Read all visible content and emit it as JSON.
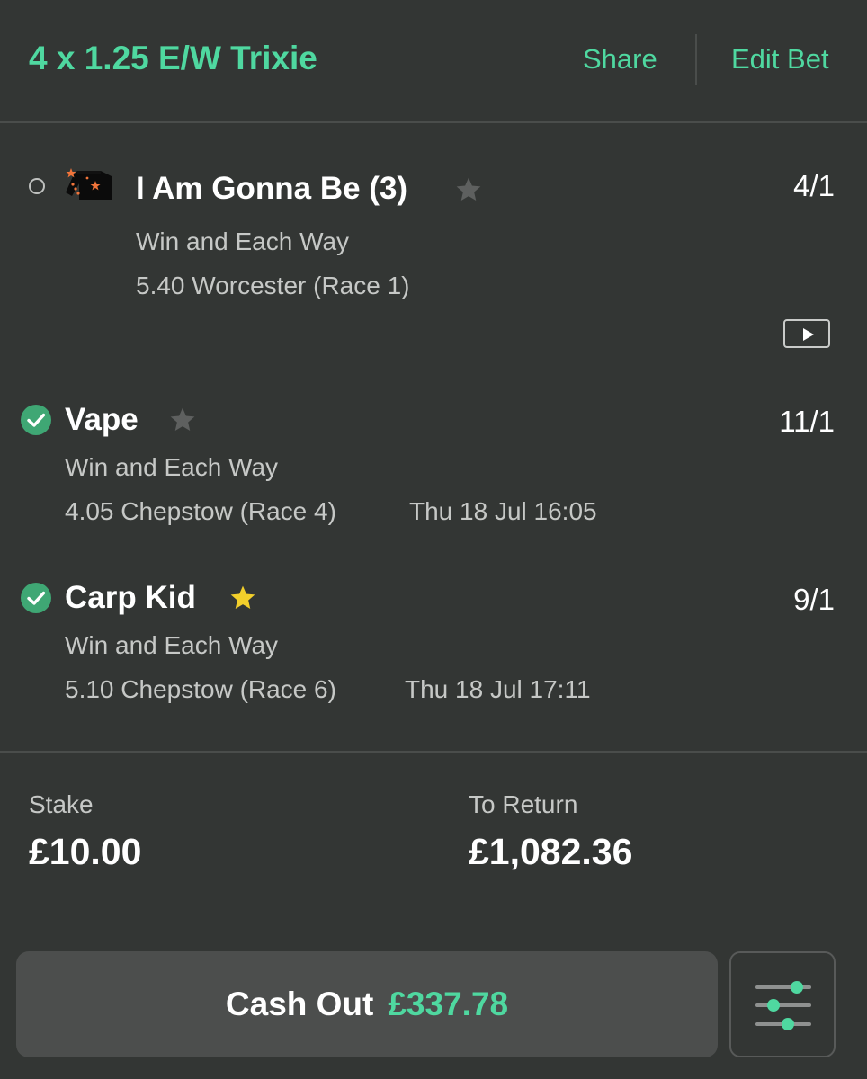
{
  "header": {
    "title": "4 x 1.25 E/W Trixie",
    "share_label": "Share",
    "edit_label": "Edit Bet"
  },
  "selections": [
    {
      "name": "I Am Gonna Be (3)",
      "bet_type": "Win and Each Way",
      "race": "5.40 Worcester (Race 1)",
      "time": "",
      "odds": "4/1",
      "status": "pending",
      "favourite": false,
      "icons": [
        "jockey-silks-icon",
        "star-icon",
        "video-play-icon"
      ]
    },
    {
      "name": "Vape",
      "bet_type": "Win and Each Way",
      "race": "4.05 Chepstow (Race 4)",
      "time": "Thu 18 Jul 16:05",
      "odds": "11/1",
      "status": "won",
      "favourite": false,
      "icons": [
        "check-icon",
        "star-icon"
      ]
    },
    {
      "name": "Carp Kid",
      "bet_type": "Win and Each Way",
      "race": "5.10 Chepstow (Race 6)",
      "time": "Thu 18 Jul 17:11",
      "odds": "9/1",
      "status": "won",
      "favourite": true,
      "icons": [
        "check-icon",
        "star-icon"
      ]
    }
  ],
  "summary": {
    "stake_label": "Stake",
    "stake_value": "£10.00",
    "return_label": "To Return",
    "return_value": "£1,082.36"
  },
  "cashout": {
    "label": "Cash Out",
    "value": "£337.78",
    "settings_icon": "sliders-icon"
  },
  "colors": {
    "background": "#333634",
    "accent": "#4fd8a0",
    "won": "#3fa774",
    "star_active": "#f2cf2b",
    "star_inactive": "#5e605f"
  }
}
